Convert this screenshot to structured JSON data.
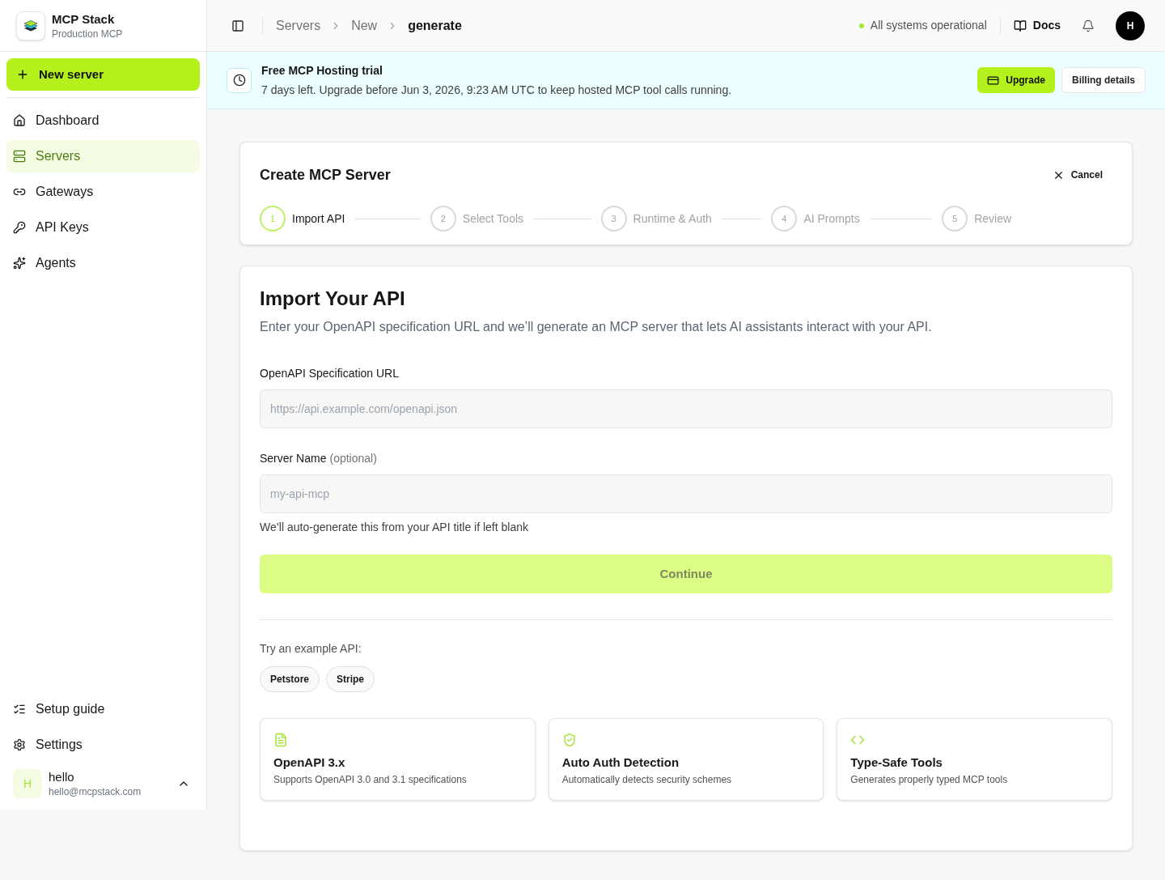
{
  "sidebar": {
    "brand": {
      "name": "MCP Stack",
      "subtitle": "Production MCP"
    },
    "new_button": "New server",
    "items": [
      {
        "label": "Dashboard",
        "selected": false
      },
      {
        "label": "Servers",
        "selected": true
      },
      {
        "label": "Gateways",
        "selected": false
      },
      {
        "label": "API Keys",
        "selected": false
      },
      {
        "label": "Agents",
        "selected": false
      }
    ],
    "footer_items": [
      {
        "label": "Setup guide",
        "selected": false
      },
      {
        "label": "Settings",
        "selected": false
      }
    ],
    "user": {
      "initial": "H",
      "name": "hello",
      "email": "hello@mcpstack.com"
    }
  },
  "topbar": {
    "breadcrumbs": [
      {
        "label": "Servers",
        "current": false
      },
      {
        "label": "New",
        "current": false
      },
      {
        "label": "generate",
        "current": true
      }
    ],
    "status": "All systems operational",
    "docs": "Docs",
    "avatar": "H"
  },
  "banner": {
    "title": "Free MCP Hosting trial",
    "message": "7 days left. Upgrade before Jun 3, 2026, 9:23 AM UTC to keep hosted MCP tool calls running.",
    "upgrade": "Upgrade",
    "billing": "Billing details"
  },
  "wizard": {
    "title": "Create MCP Server",
    "cancel": "Cancel",
    "steps": [
      {
        "number": "1",
        "label": "Import API",
        "selected": true
      },
      {
        "number": "2",
        "label": "Select Tools",
        "selected": false
      },
      {
        "number": "3",
        "label": "Runtime & Auth",
        "selected": false
      },
      {
        "number": "4",
        "label": "AI Prompts",
        "selected": false
      },
      {
        "number": "5",
        "label": "Review",
        "selected": false
      }
    ]
  },
  "import": {
    "title": "Import Your API",
    "description": "Enter your OpenAPI specification URL and we’ll generate an MCP server that lets AI assistants interact with your API.",
    "fields": [
      {
        "label": "OpenAPI Specification URL",
        "placeholder": "https://api.example.com/openapi.json"
      },
      {
        "label": "Server Name",
        "note": "(optional)",
        "placeholder": "my-api-mcp",
        "help": "We’ll auto-generate this from your API title if left blank"
      }
    ],
    "continue": {
      "label": "Continue",
      "disabled": true
    },
    "examples_label": "Try an example API:",
    "examples": [
      "Petstore",
      "Stripe"
    ],
    "features": [
      {
        "title": "OpenAPI 3.x",
        "description": "Supports OpenAPI 3.0 and 3.1 specifications"
      },
      {
        "title": "Auto Auth Detection",
        "description": "Automatically detects security schemes"
      },
      {
        "title": "Type-Safe Tools",
        "description": "Generates properly typed MCP tools"
      }
    ]
  }
}
